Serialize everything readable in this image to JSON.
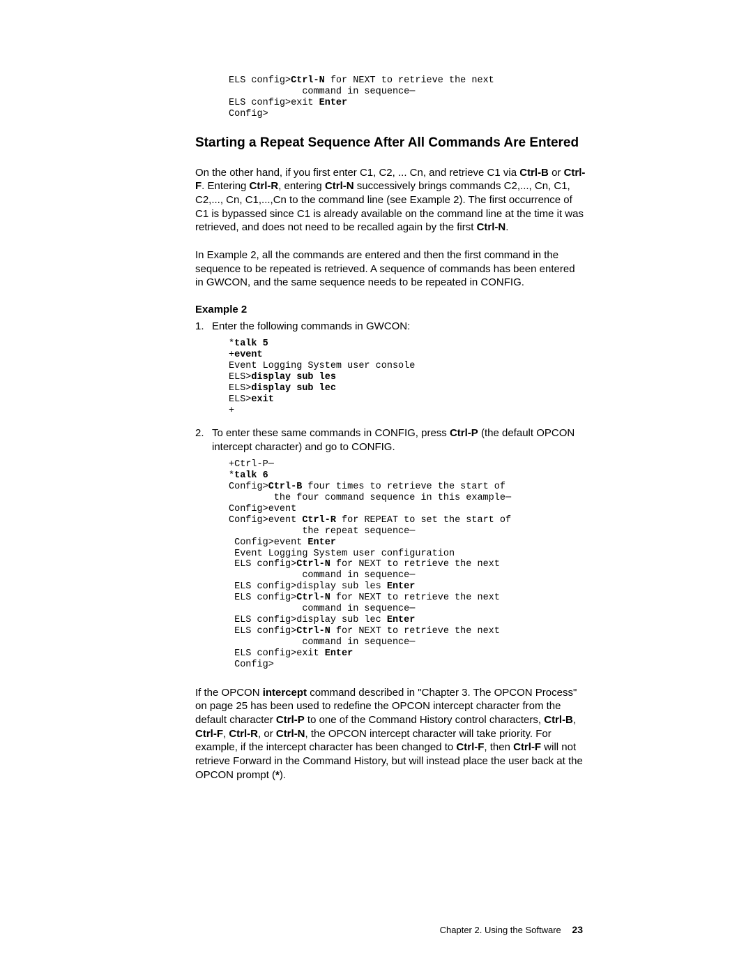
{
  "codeTop": {
    "l1a": "ELS config>",
    "l1b": "Ctrl-N",
    "l1c": " for NEXT to retrieve the next",
    "l2": "             command in sequence─",
    "l3a": "ELS config>exit ",
    "l3b": "Enter",
    "l4": "Config>"
  },
  "heading": "Starting a Repeat Sequence After All Commands Are Entered",
  "para1": {
    "t1": "On the other hand, if you first enter C1, C2, ... Cn, and retrieve C1 via ",
    "b1": "Ctrl-B",
    "t2": " or ",
    "b2": "Ctrl-F",
    "t3": ". Entering ",
    "b3": "Ctrl-R",
    "t4": ", entering ",
    "b4": "Ctrl-N",
    "t5": " successively brings commands C2,..., Cn, C1, C2,..., Cn, C1,...,Cn to the command line (see Example 2). The first occurrence of C1 is bypassed since C1 is already available on the command line at the time it was retrieved, and does not need to be recalled again by the first ",
    "b5": "Ctrl-N",
    "t6": "."
  },
  "para2": "In Example 2, all the commands are entered and then the first command in the sequence to be repeated is retrieved. A sequence of commands has been entered in GWCON, and the same sequence needs to be repeated in CONFIG.",
  "exampleLabel": "Example 2",
  "step1": {
    "num": "1.",
    "text": "Enter the following commands in GWCON:"
  },
  "code1": {
    "l1": "*",
    "l1b": "talk 5",
    "l2": "+",
    "l2b": "event",
    "l3": "Event Logging System user console",
    "l4": "ELS>",
    "l4b": "display sub les",
    "l5": "ELS>",
    "l5b": "display sub lec",
    "l6": "ELS>",
    "l6b": "exit",
    "l7": "+"
  },
  "step2": {
    "num": "2.",
    "t1": "To enter these same commands in CONFIG, press ",
    "b1": "Ctrl-P",
    "t2": " (the default OPCON intercept character) and go to CONFIG."
  },
  "code2": {
    "l1": "+Ctrl-P─",
    "l2": "*",
    "l2b": "talk 6",
    "l3a": "Config>",
    "l3b": "Ctrl-B",
    "l3c": " four times to retrieve the start of",
    "l4": "        the four command sequence in this example─",
    "l5": "Config>event",
    "l6a": "Config>event ",
    "l6b": "Ctrl-R",
    "l6c": " for REPEAT to set the start of",
    "l7": "             the repeat sequence─",
    "l8a": " Config>event ",
    "l8b": "Enter",
    "l9": " Event Logging System user configuration",
    "l10a": " ELS config>",
    "l10b": "Ctrl-N",
    "l10c": " for NEXT to retrieve the next",
    "l11": "             command in sequence─",
    "l12a": " ELS config>display sub les ",
    "l12b": "Enter",
    "l13a": " ELS config>",
    "l13b": "Ctrl-N",
    "l13c": " for NEXT to retrieve the next",
    "l14": "             command in sequence─",
    "l15a": " ELS config>display sub lec ",
    "l15b": "Enter",
    "l16a": " ELS config>",
    "l16b": "Ctrl-N",
    "l16c": " for NEXT to retrieve the next",
    "l17": "             command in sequence─",
    "l18a": " ELS config>exit ",
    "l18b": "Enter",
    "l19": " Config>"
  },
  "para3": {
    "t1": "If the OPCON ",
    "b1": "intercept",
    "t2": " command described in \"Chapter 3. The OPCON Process\"  on page 25 has been used to redefine the OPCON intercept character from the default character ",
    "b2": "Ctrl-P",
    "t3": " to one of the Command History control characters, ",
    "b3": "Ctrl-B",
    "t4": ", ",
    "b4": "Ctrl-F",
    "t5": ", ",
    "b5": "Ctrl-R",
    "t6": ", or ",
    "b6": "Ctrl-N",
    "t7": ", the OPCON intercept character will take priority. For example, if the intercept character has been changed to ",
    "b7": "Ctrl-F",
    "t8": ", then ",
    "b8": "Ctrl-F",
    "t9": " will not retrieve Forward in the Command History, but will instead place the user back at the OPCON prompt (",
    "b9": "*",
    "t10": ")."
  },
  "footer": {
    "chapter": "Chapter 2. Using the Software",
    "page": "23"
  }
}
